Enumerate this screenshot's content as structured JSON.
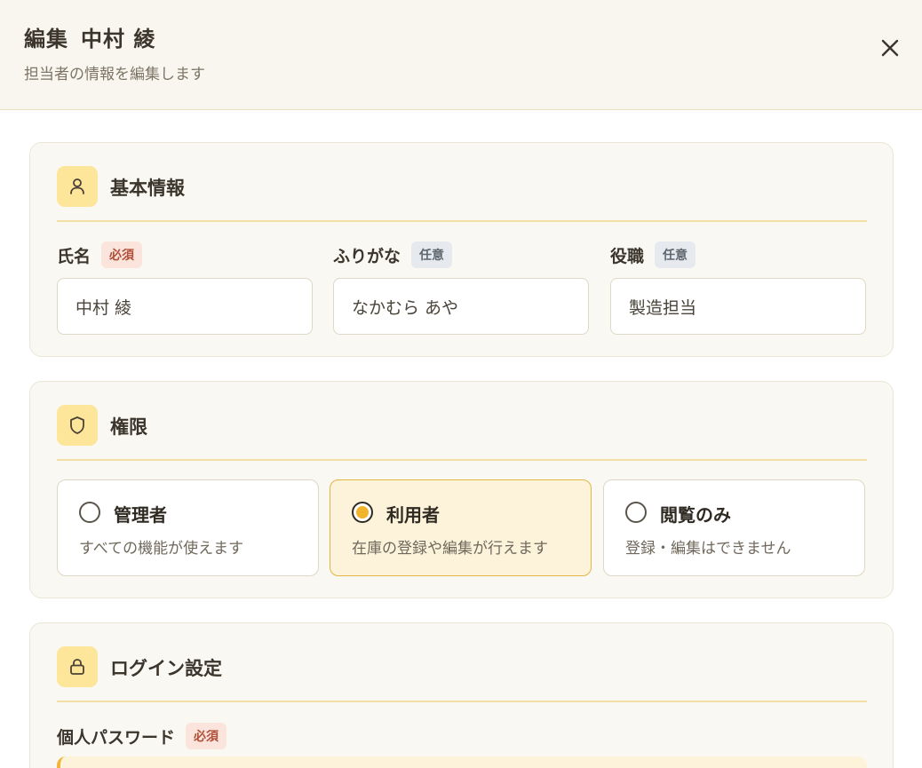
{
  "header": {
    "title_prefix": "編集",
    "title_name": "中村 綾",
    "subtitle": "担当者の情報を編集します",
    "close_icon": "close-icon"
  },
  "basic": {
    "title": "基本情報",
    "icon": "user-icon",
    "fields": [
      {
        "label": "氏名",
        "tag": "必須",
        "value": "中村 綾"
      },
      {
        "label": "ふりがな",
        "tag": "任意",
        "value": "なかむら あや"
      },
      {
        "label": "役職",
        "tag": "任意",
        "value": "製造担当"
      }
    ]
  },
  "permission": {
    "title": "権限",
    "icon": "shield-icon",
    "selected": "利用者",
    "options": [
      {
        "title": "管理者",
        "desc": "すべての機能が使えます"
      },
      {
        "title": "利用者",
        "desc": "在庫の登録や編集が行えます"
      },
      {
        "title": "閲覧のみ",
        "desc": "登録・編集はできません"
      }
    ]
  },
  "login": {
    "title": "ログイン設定",
    "icon": "lock-icon",
    "password_label": "個人パスワード",
    "password_tag": "必須"
  }
}
